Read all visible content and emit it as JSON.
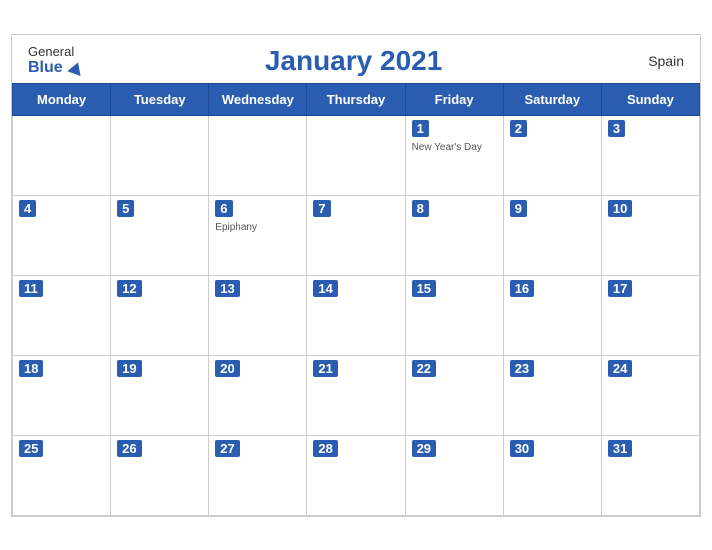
{
  "header": {
    "logo_general": "General",
    "logo_blue": "Blue",
    "month_title": "January 2021",
    "country": "Spain"
  },
  "weekdays": [
    "Monday",
    "Tuesday",
    "Wednesday",
    "Thursday",
    "Friday",
    "Saturday",
    "Sunday"
  ],
  "weeks": [
    [
      {
        "num": "",
        "event": ""
      },
      {
        "num": "",
        "event": ""
      },
      {
        "num": "",
        "event": ""
      },
      {
        "num": "",
        "event": ""
      },
      {
        "num": "1",
        "event": "New Year's Day"
      },
      {
        "num": "2",
        "event": ""
      },
      {
        "num": "3",
        "event": ""
      }
    ],
    [
      {
        "num": "4",
        "event": ""
      },
      {
        "num": "5",
        "event": ""
      },
      {
        "num": "6",
        "event": "Epiphany"
      },
      {
        "num": "7",
        "event": ""
      },
      {
        "num": "8",
        "event": ""
      },
      {
        "num": "9",
        "event": ""
      },
      {
        "num": "10",
        "event": ""
      }
    ],
    [
      {
        "num": "11",
        "event": ""
      },
      {
        "num": "12",
        "event": ""
      },
      {
        "num": "13",
        "event": ""
      },
      {
        "num": "14",
        "event": ""
      },
      {
        "num": "15",
        "event": ""
      },
      {
        "num": "16",
        "event": ""
      },
      {
        "num": "17",
        "event": ""
      }
    ],
    [
      {
        "num": "18",
        "event": ""
      },
      {
        "num": "19",
        "event": ""
      },
      {
        "num": "20",
        "event": ""
      },
      {
        "num": "21",
        "event": ""
      },
      {
        "num": "22",
        "event": ""
      },
      {
        "num": "23",
        "event": ""
      },
      {
        "num": "24",
        "event": ""
      }
    ],
    [
      {
        "num": "25",
        "event": ""
      },
      {
        "num": "26",
        "event": ""
      },
      {
        "num": "27",
        "event": ""
      },
      {
        "num": "28",
        "event": ""
      },
      {
        "num": "29",
        "event": ""
      },
      {
        "num": "30",
        "event": ""
      },
      {
        "num": "31",
        "event": ""
      }
    ]
  ]
}
